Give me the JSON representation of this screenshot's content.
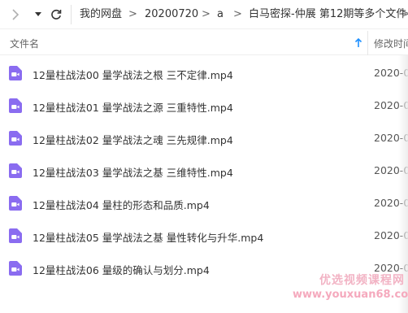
{
  "breadcrumb": [
    {
      "label": "我的网盘"
    },
    {
      "label": "20200720"
    },
    {
      "label": "a"
    },
    {
      "label": "白马密探-仲展 第12期等多个文件"
    }
  ],
  "breadcrumb_separator": ">",
  "table_header": {
    "name": "文件名",
    "modified": "修改时间"
  },
  "files": [
    {
      "name": "12量柱战法00 量学战法之根 三不定律.mp4",
      "date": "2020-0"
    },
    {
      "name": "12量柱战法01 量学战法之源 三重特性.mp4",
      "date": "2020-0"
    },
    {
      "name": "12量柱战法02 量学战法之魂 三先规律.mp4",
      "date": "2020-0"
    },
    {
      "name": "12量柱战法03 量学战法之基 三维特性.mp4",
      "date": "2020-0"
    },
    {
      "name": "12量柱战法04 量柱的形态和品质.mp4",
      "date": "2020-0"
    },
    {
      "name": "12量柱战法05 量学战法之基 量性转化与升华.mp4",
      "date": "2020-0"
    },
    {
      "name": "12量柱战法06 量级的确认与划分.mp4",
      "date": "2020-0"
    }
  ],
  "watermark": {
    "line1": "优选视频课程网",
    "line2": "www.youxuan68.com"
  },
  "icons": {
    "forward": "chevron-right-icon",
    "dropdown": "caret-down-icon",
    "refresh": "refresh-icon",
    "sort": "arrow-up-icon",
    "file": "video-file-icon"
  },
  "colors": {
    "video_icon": "#8a6cf0",
    "sort_arrow": "#1e90ff",
    "watermark": "#f2b3c4"
  }
}
